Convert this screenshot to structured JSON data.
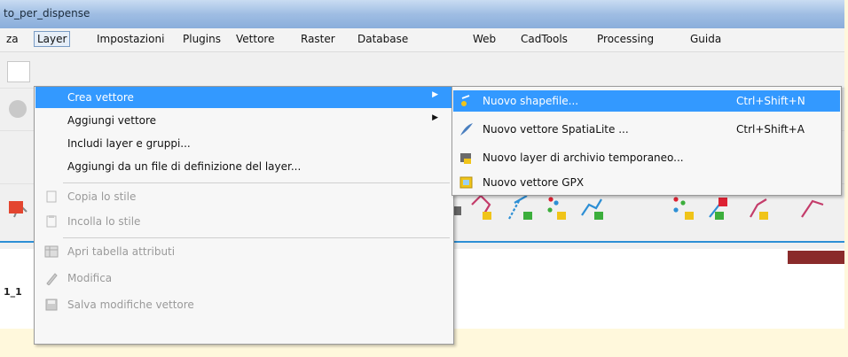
{
  "window": {
    "title": "to_per_dispense"
  },
  "menubar": {
    "items": [
      {
        "label": "za"
      },
      {
        "label": "Layer"
      },
      {
        "label": "Impostazioni"
      },
      {
        "label": "Plugins"
      },
      {
        "label": "Vettore"
      },
      {
        "label": "Raster"
      },
      {
        "label": "Database"
      },
      {
        "label": "Web"
      },
      {
        "label": "CadTools"
      },
      {
        "label": "Processing"
      },
      {
        "label": "Guida"
      }
    ]
  },
  "layer_menu": {
    "items": [
      {
        "label": "Crea vettore",
        "has_submenu": true
      },
      {
        "label": "Aggiungi vettore",
        "has_submenu": true
      },
      {
        "label": "Includi layer e gruppi..."
      },
      {
        "label": "Aggiungi da un file di definizione del layer..."
      },
      {
        "label": "Copia lo stile"
      },
      {
        "label": "Incolla lo stile"
      },
      {
        "label": "Apri tabella attributi"
      },
      {
        "label": "Modifica"
      },
      {
        "label": "Salva modifiche vettore"
      }
    ]
  },
  "submenu": {
    "items": [
      {
        "label": "Nuovo shapefile...",
        "shortcut": "Ctrl+Shift+N"
      },
      {
        "label": "Nuovo vettore SpatiaLite ...",
        "shortcut": "Ctrl+Shift+A"
      },
      {
        "label": "Nuovo layer di archivio temporaneo..."
      },
      {
        "label": "Nuovo vettore GPX"
      }
    ]
  },
  "left_stubs": {
    "row1": "1_1"
  },
  "colors": {
    "highlight": "#3399ff",
    "titlebar": "#9fbde3",
    "accent_red": "#8a2b2b",
    "frame": "#fff8dc"
  }
}
